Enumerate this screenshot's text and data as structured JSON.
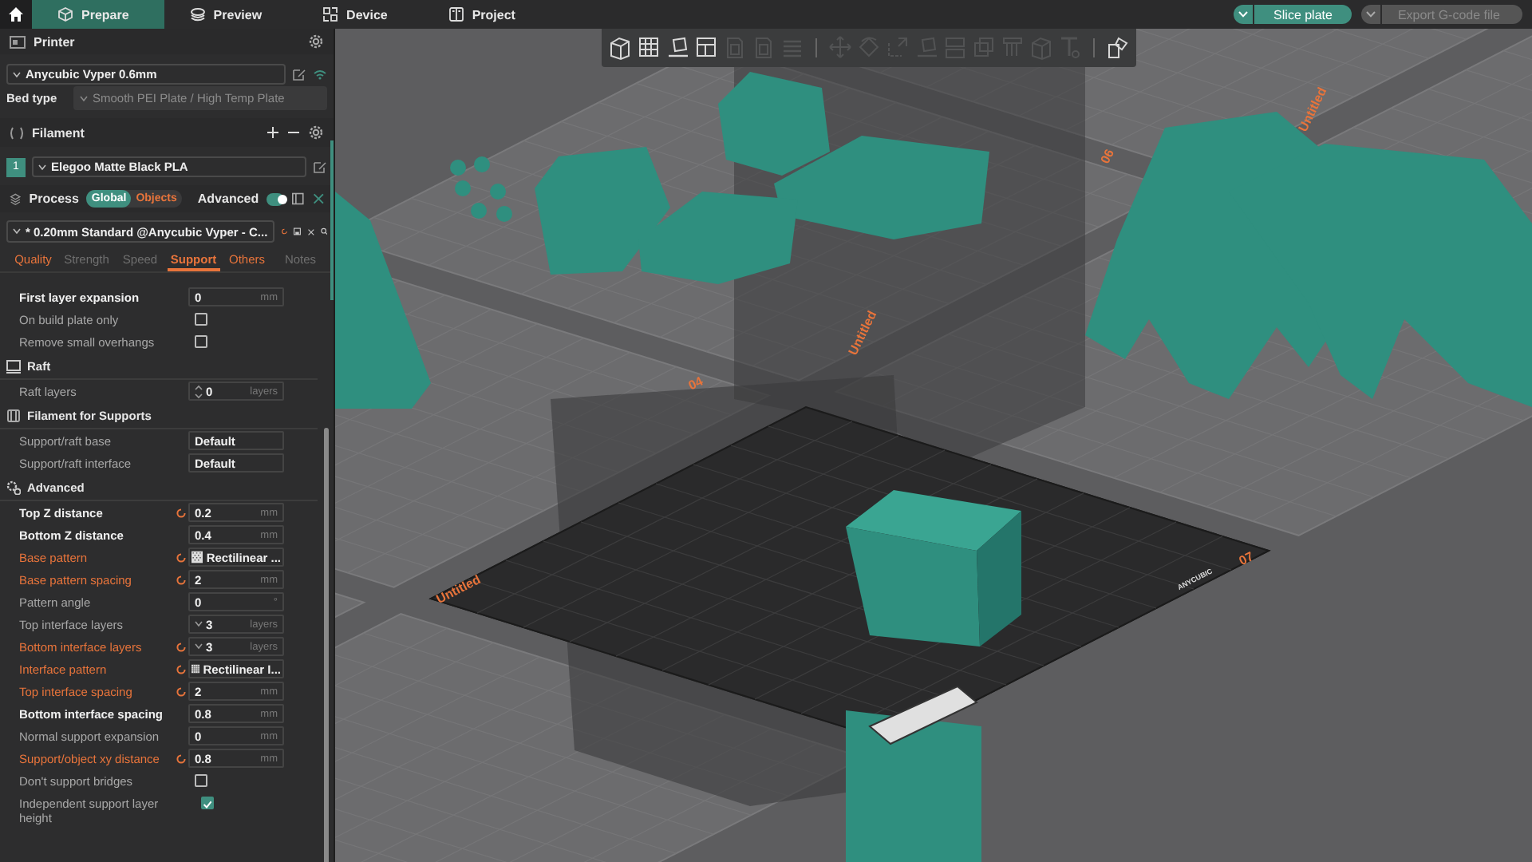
{
  "top_bar": {
    "tabs": [
      {
        "label": "Prepare",
        "selected": true
      },
      {
        "label": "Preview",
        "selected": false
      },
      {
        "label": "Device",
        "selected": false
      },
      {
        "label": "Project",
        "selected": false
      }
    ],
    "slice_button": {
      "label": "Slice plate",
      "disabled": false
    },
    "export_button": {
      "label": "Export G-code file",
      "disabled": true
    }
  },
  "sidebar": {
    "printer": {
      "title": "Printer",
      "preset": "Anycubic Vyper 0.6mm",
      "bed_label": "Bed type",
      "bed_value": "Smooth PEI Plate / High Temp Plate"
    },
    "filament": {
      "title": "Filament",
      "slots": [
        {
          "index": "1",
          "name": "Elegoo Matte Black PLA"
        }
      ]
    },
    "process": {
      "title": "Process",
      "scope": [
        {
          "label": "Global",
          "selected": true
        },
        {
          "label": "Objects",
          "selected": false
        }
      ],
      "advanced_label": "Advanced",
      "advanced_on": true,
      "preset": "* 0.20mm Standard @Anycubic Vyper - C..."
    },
    "tabs": [
      {
        "label": "Quality",
        "selected": false,
        "modified": true
      },
      {
        "label": "Strength",
        "selected": false,
        "modified": false
      },
      {
        "label": "Speed",
        "selected": false,
        "modified": false
      },
      {
        "label": "Support",
        "selected": true,
        "modified": true
      },
      {
        "label": "Others",
        "selected": false,
        "modified": true
      },
      {
        "label": "Notes",
        "selected": false,
        "modified": false
      }
    ],
    "rows": [
      {
        "kind": "input",
        "label": "First layer expansion",
        "value": "0",
        "unit": "mm",
        "emphasis": true,
        "modified": false
      },
      {
        "kind": "checkbox",
        "label": "On build plate only",
        "checked": false
      },
      {
        "kind": "checkbox",
        "label": "Remove small overhangs",
        "checked": false
      },
      {
        "kind": "header",
        "label": "Raft"
      },
      {
        "kind": "spin",
        "label": "Raft layers",
        "value": "0",
        "unit": "layers",
        "emphasis": false,
        "modified": false
      },
      {
        "kind": "header",
        "label": "Filament for Supports"
      },
      {
        "kind": "select",
        "label": "Support/raft base",
        "value": "Default",
        "emphasis": false,
        "modified": false
      },
      {
        "kind": "select",
        "label": "Support/raft interface",
        "value": "Default",
        "emphasis": false,
        "modified": false
      },
      {
        "kind": "header",
        "label": "Advanced"
      },
      {
        "kind": "input",
        "label": "Top Z distance",
        "value": "0.2",
        "unit": "mm",
        "emphasis": true,
        "modified": false,
        "resettable": true
      },
      {
        "kind": "input",
        "label": "Bottom Z distance",
        "value": "0.4",
        "unit": "mm",
        "emphasis": true,
        "modified": false
      },
      {
        "kind": "pattern",
        "label": "Base pattern",
        "value": "Rectilinear ...",
        "emphasis": false,
        "modified": true,
        "resettable": true
      },
      {
        "kind": "input",
        "label": "Base pattern spacing",
        "value": "2",
        "unit": "mm",
        "emphasis": false,
        "modified": true,
        "resettable": true
      },
      {
        "kind": "input",
        "label": "Pattern angle",
        "value": "0",
        "unit": "°",
        "emphasis": false,
        "modified": false
      },
      {
        "kind": "combo",
        "label": "Top interface layers",
        "value": "3",
        "unit": "layers",
        "emphasis": false,
        "modified": false
      },
      {
        "kind": "combo",
        "label": "Bottom interface layers",
        "value": "3",
        "unit": "layers",
        "emphasis": false,
        "modified": true,
        "resettable": true
      },
      {
        "kind": "pattern",
        "label": "Interface pattern",
        "value": "Rectilinear I...",
        "emphasis": false,
        "modified": true,
        "resettable": true
      },
      {
        "kind": "input",
        "label": "Top interface spacing",
        "value": "2",
        "unit": "mm",
        "emphasis": false,
        "modified": true,
        "resettable": true
      },
      {
        "kind": "input",
        "label": "Bottom interface spacing",
        "value": "0.8",
        "unit": "mm",
        "emphasis": true,
        "modified": false
      },
      {
        "kind": "input",
        "label": "Normal support expansion",
        "value": "0",
        "unit": "mm",
        "emphasis": false,
        "modified": false
      },
      {
        "kind": "input",
        "label": "Support/object xy distance",
        "value": "0.8",
        "unit": "mm",
        "emphasis": false,
        "modified": true,
        "resettable": true
      },
      {
        "kind": "checkbox",
        "label": "Don't support bridges",
        "checked": false
      },
      {
        "kind": "checkbox",
        "label": "Independent support layer height",
        "checked": true
      }
    ]
  },
  "viewport": {
    "toolbar": [
      {
        "kind": "cube",
        "disabled": false
      },
      {
        "kind": "grid",
        "disabled": false
      },
      {
        "kind": "flatten",
        "disabled": false
      },
      {
        "kind": "arrange",
        "disabled": false
      },
      {
        "kind": "page",
        "disabled": true
      },
      {
        "kind": "page",
        "disabled": true
      },
      {
        "kind": "stack",
        "disabled": true
      },
      {
        "kind": "divider"
      },
      {
        "kind": "move",
        "disabled": true
      },
      {
        "kind": "rotate",
        "disabled": true
      },
      {
        "kind": "scale",
        "disabled": true
      },
      {
        "kind": "flatten",
        "disabled": true
      },
      {
        "kind": "split",
        "disabled": true
      },
      {
        "kind": "cut",
        "disabled": true
      },
      {
        "kind": "support",
        "disabled": true
      },
      {
        "kind": "cube",
        "disabled": true
      },
      {
        "kind": "text",
        "disabled": true
      },
      {
        "kind": "divider"
      },
      {
        "kind": "assembly",
        "disabled": false
      }
    ],
    "plate_labels": [
      "06",
      "Untitled",
      "04",
      "Untitled",
      "Untitled",
      "07"
    ],
    "bed_logo": "ANYCUBIC"
  }
}
